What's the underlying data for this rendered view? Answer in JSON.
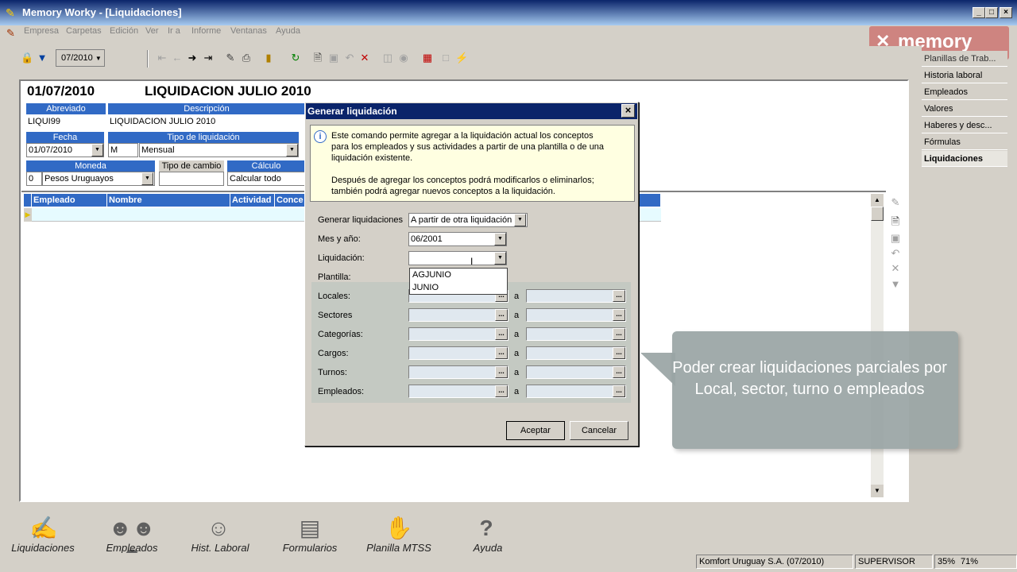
{
  "window": {
    "title": "Memory Worky - [Liquidaciones]"
  },
  "menu": [
    "Empresa",
    "Carpetas",
    "Edición",
    "Ver",
    "Ir a",
    "Informe",
    "Ventanas",
    "Ayuda"
  ],
  "toolbar": {
    "period": "07/2010"
  },
  "brand": {
    "logo_text": "memory"
  },
  "liquidacion": {
    "date": "01/07/2010",
    "name": "LIQUIDACION JULIO 2010",
    "labels": {
      "abreviado": "Abreviado",
      "descripcion": "Descripción",
      "fecha": "Fecha",
      "tipo": "Tipo de liquidación",
      "moneda": "Moneda",
      "tipo_cambio": "Tipo de cambio",
      "calculo": "Cálculo"
    },
    "abreviado": "LIQUI99",
    "descripcion": "LIQUIDACION JULIO 2010",
    "fecha": "01/07/2010",
    "tipo_code": "M",
    "tipo": "Mensual",
    "moneda_code": "0",
    "moneda": "Pesos Uruguayos",
    "tipo_cambio": "",
    "calculo": "Calcular todo"
  },
  "grid": {
    "columns": [
      "Empleado",
      "Nombre",
      "Actividad",
      "Conce"
    ]
  },
  "right_tabs": [
    "Planillas de Trab...",
    "Historia laboral",
    "Empleados",
    "Valores",
    "Haberes y desc...",
    "Fórmulas",
    "Liquidaciones"
  ],
  "dialog": {
    "title": "Generar liquidación",
    "info1": "Este comando permite agregar a la liquidación actual los conceptos para los empleados y sus actividades a partir de una plantilla o de una liquidación existente.",
    "info2": "Después de agregar los conceptos podrá modificarlos o eliminarlos; también podrá agregar nuevos conceptos a la liquidación.",
    "labels": {
      "generar": "Generar liquidaciones",
      "mes": "Mes y año:",
      "liquidacion": "Liquidación:",
      "plantilla": "Plantilla:",
      "locales": "Locales:",
      "sectores": "Sectores",
      "categorias": "Categorías:",
      "cargos": "Cargos:",
      "turnos": "Turnos:",
      "empleados": "Empleados:"
    },
    "generar_value": "A partir de otra liquidación",
    "mes_value": "06/2001",
    "liquidacion_value": "",
    "dropdown_options": [
      "AGJUNIO",
      "JUNIO"
    ],
    "range_sep": "a",
    "accept": "Aceptar",
    "cancel": "Cancelar"
  },
  "callout": {
    "text": "Poder crear liquidaciones parciales por Local, sector, turno o empleados"
  },
  "bottom": [
    "Liquidaciones",
    "Empleados",
    "Hist. Laboral",
    "Formularios",
    "Planilla MTSS",
    "Ayuda"
  ],
  "status": {
    "company": "Komfort Uruguay S.A. (07/2010)",
    "user": "SUPERVISOR",
    "z1": "35%",
    "z2": "71%"
  }
}
